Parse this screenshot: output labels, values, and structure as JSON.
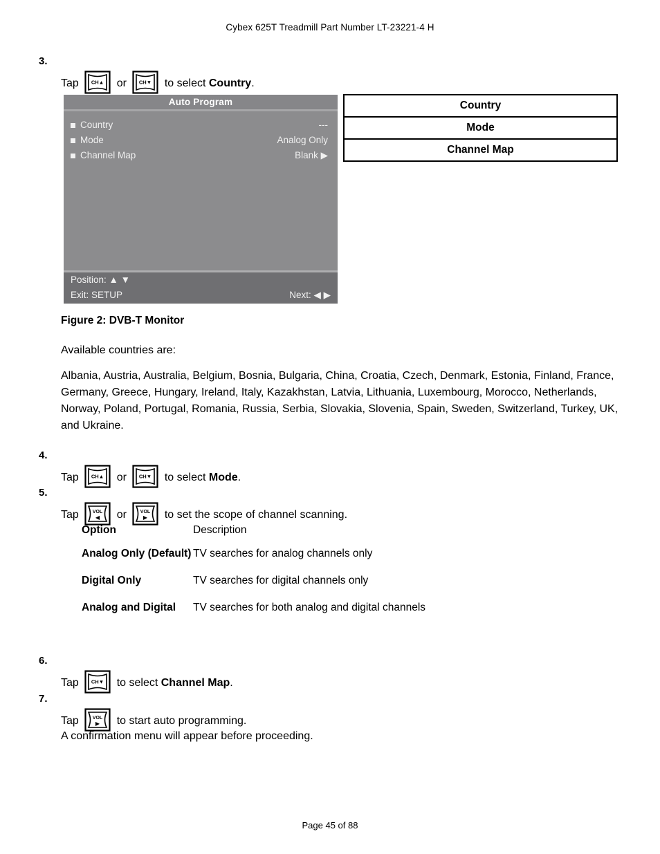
{
  "document": {
    "header": "Cybex 625T Treadmill Part Number LT-23221-4 H",
    "footer": "Page 45 of 88"
  },
  "steps": {
    "s3": {
      "number": "3.",
      "tap": "Tap",
      "or": "or",
      "text_tail": "to select ",
      "target": "Country",
      "period": ".",
      "icon1": "ch-up-key-icon",
      "icon2": "ch-down-key-icon"
    },
    "s4": {
      "number": "4.",
      "tap": "Tap",
      "or": "or",
      "text_tail": "to select ",
      "target": "Mode",
      "period": ".",
      "icon1": "ch-up-key-icon",
      "icon2": "ch-down-key-icon"
    },
    "s5": {
      "number": "5.",
      "tap": "Tap",
      "or": "or",
      "text_tail": "to set the scope of channel scanning.",
      "icon1": "vol-left-key-icon",
      "icon2": "vol-right-key-icon"
    },
    "s6": {
      "number": "6.",
      "tap": "Tap",
      "text_tail": "to select ",
      "target": "Channel Map",
      "period": ".",
      "icon1": "ch-down-key-icon"
    },
    "s7": {
      "number": "7.",
      "tap": "Tap",
      "text_tail": "to start auto programming.",
      "note": "A confirmation menu will appear before proceeding.",
      "icon1": "vol-right-key-icon"
    }
  },
  "osd": {
    "title": "Auto Program",
    "rows": [
      {
        "label": "Country",
        "value": "---"
      },
      {
        "label": "Mode",
        "value": "Analog Only"
      },
      {
        "label": "Channel Map",
        "value": "Blank ▶"
      }
    ],
    "footer": {
      "position": "Position: ▲ ▼",
      "exit": "Exit: SETUP",
      "next": "Next: ◀ ▶"
    },
    "colors": {
      "panel_bg": "#8c8c8e",
      "title_bg": "#868689",
      "footer_bg": "#6f6f72",
      "separator": "#a6a6a8",
      "text": "#f0f0f0"
    }
  },
  "menu_table": {
    "rows": [
      "Country",
      "Mode",
      "Channel Map"
    ]
  },
  "figure": {
    "caption": "Figure 2: DVB-T Monitor",
    "intro": "Available countries are:",
    "countries": "Albania, Austria, Australia, Belgium, Bosnia, Bulgaria, China, Croatia, Czech, Denmark, Estonia, Finland, France, Germany, Greece, Hungary, Ireland, Italy, Kazakhstan, Latvia, Lithuania, Luxembourg, Morocco, Netherlands, Norway, Poland, Portugal, Romania, Russia, Serbia, Slovakia, Slovenia, Spain, Sweden, Switzerland, Turkey, UK, and Ukraine."
  },
  "options_table": {
    "headers": [
      "Option",
      "Description"
    ],
    "rows": [
      {
        "option": "Analog Only (Default)",
        "description": "TV searches for analog channels only"
      },
      {
        "option": "Digital Only",
        "description": "TV searches for digital channels only"
      },
      {
        "option": "Analog and Digital",
        "description": "TV searches for both analog and digital channels"
      }
    ]
  },
  "icons": {
    "ch_up_label": "CH",
    "ch_down_label": "CH",
    "vol_label": "VOL",
    "up_glyph": "▲",
    "down_glyph": "▼",
    "left_glyph": "◀",
    "right_glyph": "▶"
  }
}
